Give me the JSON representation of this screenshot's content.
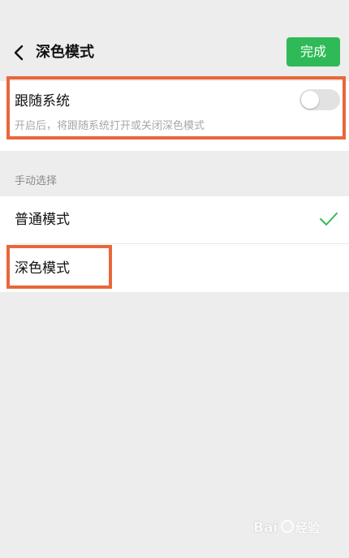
{
  "header": {
    "title": "深色模式",
    "done_label": "完成",
    "back_icon": "chevron-left-icon"
  },
  "follow_system": {
    "label": "跟随系统",
    "description": "开启后，将跟随系统打开或关闭深色模式",
    "toggle_on": false
  },
  "manual": {
    "section_label": "手动选择",
    "options": [
      {
        "label": "普通模式",
        "selected": true
      },
      {
        "label": "深色模式",
        "selected": false
      }
    ]
  },
  "colors": {
    "accent": "#2fba57",
    "highlight": "#e8673a",
    "background": "#ededed"
  }
}
